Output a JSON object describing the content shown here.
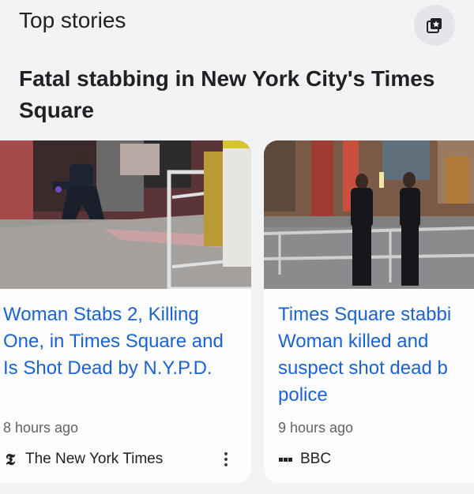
{
  "section": {
    "title": "Top stories",
    "action_icon": "star-bookmark-icon"
  },
  "story": {
    "headline": "Fatal stabbing in New York City's Times Square"
  },
  "cards": [
    {
      "title": "Woman Stabs 2, Killing One, in Times Square and Is Shot Dead by N.Y.P.D.",
      "time": "8 hours ago",
      "source": "The New York Times",
      "source_icon": "nyt-logo-icon"
    },
    {
      "title": "Times Square stabbi Woman killed and suspect shot dead b police",
      "title_lines": [
        "Times Square stabbi",
        "Woman killed and",
        "suspect shot dead b",
        "police"
      ],
      "time": "9 hours ago",
      "source": "BBC",
      "source_icon": "bbc-logo-icon"
    }
  ],
  "colors": {
    "link": "#1a63d0",
    "background": "#f2f3f4",
    "card": "#fdfdfd"
  }
}
